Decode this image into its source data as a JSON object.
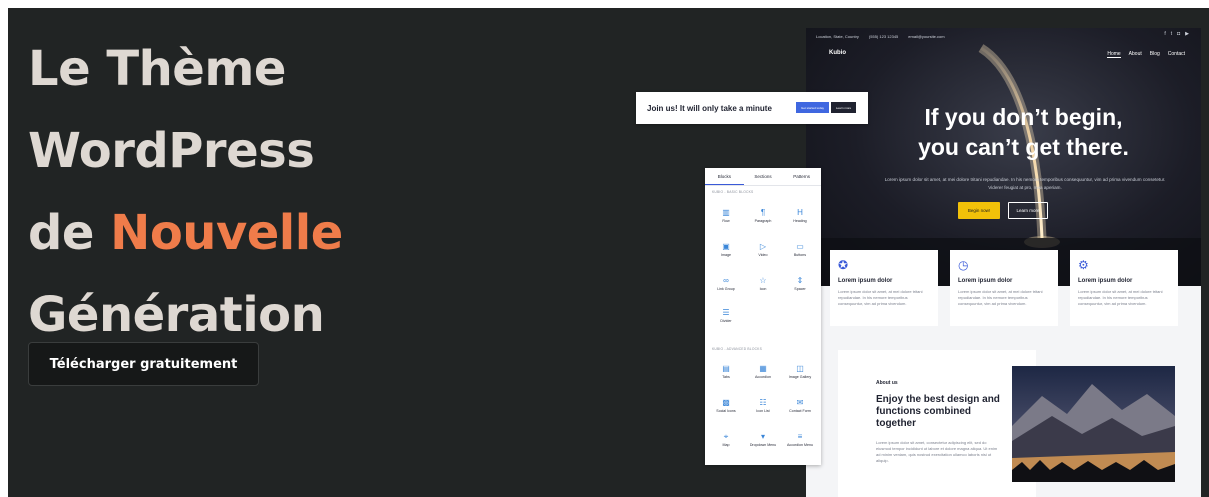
{
  "hero": {
    "title_line1": "Le Thème",
    "title_line2": "WordPress",
    "title_line3_prefix": "de",
    "title_line3_accent": "Nouvelle",
    "title_line4": "Génération",
    "cta_label": "Télécharger gratuitement",
    "accent_color": "#ef7c4a",
    "text_color": "#ded8d2",
    "background": "#212424"
  },
  "popup": {
    "text": "Join us! It will only take a minute",
    "primary_label": "Get started today",
    "secondary_label": "Learn more"
  },
  "panel": {
    "tabs": [
      "Blocks",
      "Sections",
      "Patterns"
    ],
    "basic_label": "KUBIO - BASIC BLOCKS",
    "basic_blocks": [
      {
        "label": "Row",
        "icon": "row-icon"
      },
      {
        "label": "Paragraph",
        "icon": "paragraph-icon"
      },
      {
        "label": "Heading",
        "icon": "heading-icon"
      },
      {
        "label": "Image",
        "icon": "image-icon"
      },
      {
        "label": "Video",
        "icon": "video-icon"
      },
      {
        "label": "Buttons",
        "icon": "buttons-icon"
      },
      {
        "label": "Link Group",
        "icon": "link-icon"
      },
      {
        "label": "Icon",
        "icon": "star-icon"
      },
      {
        "label": "Spacer",
        "icon": "spacer-icon"
      },
      {
        "label": "Divider",
        "icon": "divider-icon"
      }
    ],
    "advanced_label": "KUBIO - ADVANCED BLOCKS",
    "advanced_blocks": [
      {
        "label": "Tabs",
        "icon": "tabs-icon"
      },
      {
        "label": "Accordion",
        "icon": "accordion-icon"
      },
      {
        "label": "Image Gallery",
        "icon": "gallery-icon"
      },
      {
        "label": "Social Icons",
        "icon": "social-icons-icon"
      },
      {
        "label": "Icon List",
        "icon": "icon-list-icon"
      },
      {
        "label": "Contact Form",
        "icon": "contact-form-icon"
      },
      {
        "label": "Map",
        "icon": "map-pin-icon"
      },
      {
        "label": "Dropdown Menu",
        "icon": "dropdown-menu-icon"
      },
      {
        "label": "Accordion Menu",
        "icon": "accordion-menu-icon"
      }
    ]
  },
  "site": {
    "topbar": {
      "location": "Location, State, Country",
      "phone": "(555) 123 12345",
      "email": "email@yoursite.com"
    },
    "logo": "Kubio",
    "nav": [
      "Home",
      "About",
      "Blog",
      "Contact"
    ],
    "hero_title_line1": "If you don’t begin,",
    "hero_title_line2": "you can’t get there.",
    "hero_text": "Lorem ipsum dolor sit amet, at mei dolore tritani repudiandae. In his nemore temporibus consequuntur, vim ad prima vivendum consetetur. Viderer feugiat at pro, mea aperiam.",
    "btn_begin": "Begin now!",
    "btn_learn": "Learn more",
    "features": [
      {
        "title": "Lorem ipsum dolor",
        "text": "Lorem ipsum dolor sit amet, at mei dolore tritani repudiandae. In his nemore temporibus consequuntur, vim ad prima vivendum.",
        "icon": "award-icon"
      },
      {
        "title": "Lorem ipsum dolor",
        "text": "Lorem ipsum dolor sit amet, at mei dolore tritani repudiandae. In his nemore temporibus consequuntur, vim ad prima vivendum.",
        "icon": "clock-icon"
      },
      {
        "title": "Lorem ipsum dolor",
        "text": "Lorem ipsum dolor sit amet, at mei dolore tritani repudiandae. In his nemore temporibus consequuntur, vim ad prima vivendum.",
        "icon": "gear-icon"
      }
    ],
    "about_label": "About us",
    "about_title": "Enjoy the best design and functions combined together",
    "about_text": "Lorem ipsum dolor sit amet, consectetur adipiscing elit, sed do eiusmod tempor incididunt ut labore et dolore magna aliqua. Ut enim ad minim veniam, quis nostrud exercitation ullamco laboris nisi ut aliquip.",
    "accent": "#3a5ad8",
    "begin_color": "#f2c109"
  }
}
